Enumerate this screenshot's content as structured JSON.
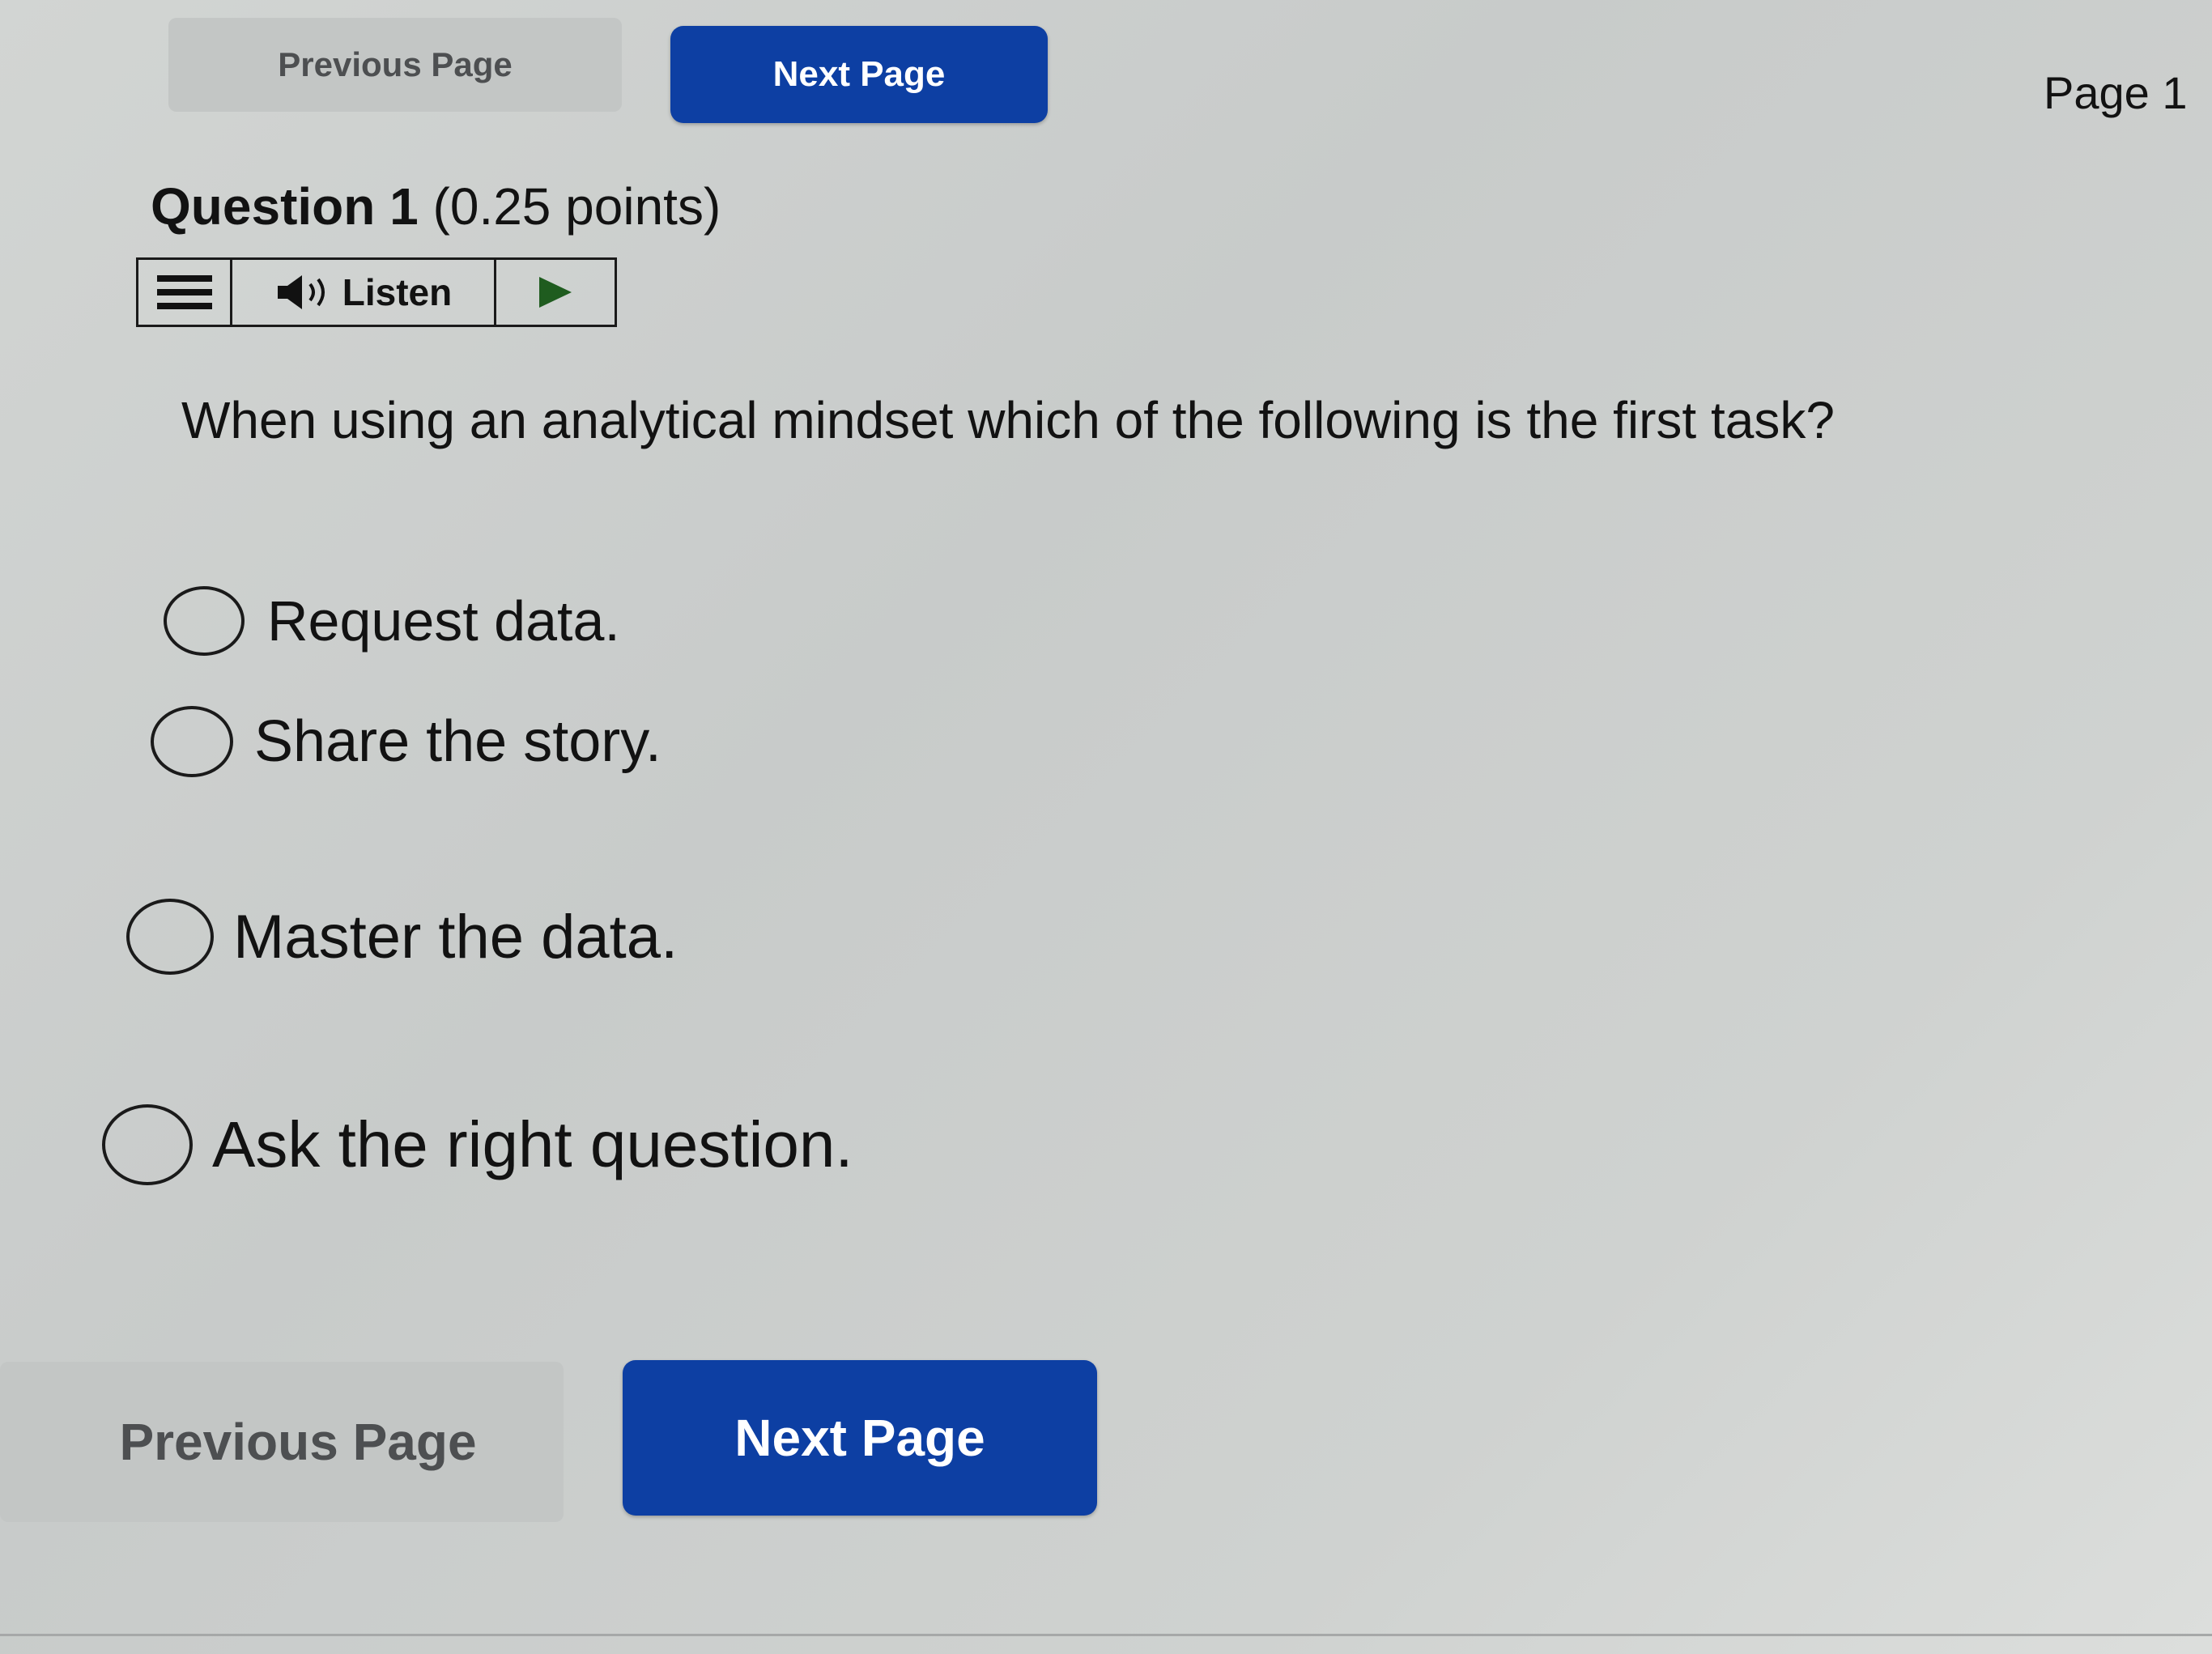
{
  "navigation": {
    "top": {
      "previous_label": "Previous Page",
      "next_label": "Next Page"
    },
    "bottom": {
      "previous_label": "Previous Page",
      "next_label": "Next Page"
    },
    "page_indicator": "Page 1"
  },
  "question": {
    "number_label": "Question 1",
    "points_label": "(0.25 points)",
    "text": "When using an analytical mindset which of the following is the first task?",
    "options": [
      {
        "label": "Request data.",
        "selected": false
      },
      {
        "label": "Share the story.",
        "selected": false
      },
      {
        "label": "Master the data.",
        "selected": false
      },
      {
        "label": "Ask the right question.",
        "selected": false
      }
    ]
  },
  "listen_toolbar": {
    "menu_icon": "hamburger-menu-icon",
    "speaker_icon": "speaker-icon",
    "listen_label": "Listen",
    "play_icon": "play-icon"
  },
  "colors": {
    "next_button": "#0d3fa3",
    "previous_button": "#c3c6c5",
    "play_icon": "#1f5c1f",
    "text": "#121212"
  }
}
